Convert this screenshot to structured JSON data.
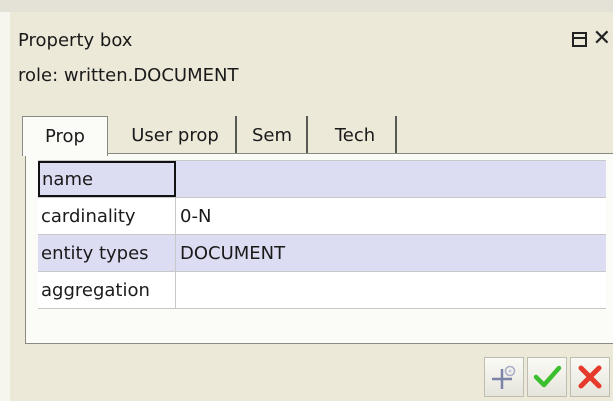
{
  "window": {
    "title": "Property box",
    "role": "role: written.DOCUMENT"
  },
  "tabs": [
    {
      "label": "Prop",
      "active": true
    },
    {
      "label": "User prop",
      "active": false
    },
    {
      "label": "Sem",
      "active": false
    },
    {
      "label": "Tech",
      "active": false
    }
  ],
  "properties": [
    {
      "name": "name",
      "value": ""
    },
    {
      "name": "cardinality",
      "value": "0-N"
    },
    {
      "name": "entity types",
      "value": "DOCUMENT"
    },
    {
      "name": "aggregation",
      "value": ""
    }
  ],
  "icons": {
    "restore": "restore-window-icon",
    "close": "close-icon",
    "add": "add-sparkle-icon",
    "confirm": "checkmark-icon",
    "cancel": "red-x-icon"
  },
  "colors": {
    "shaded_row": "#dcdcf2",
    "confirm_green": "#3cbf2e",
    "cancel_red": "#e53a2c"
  }
}
